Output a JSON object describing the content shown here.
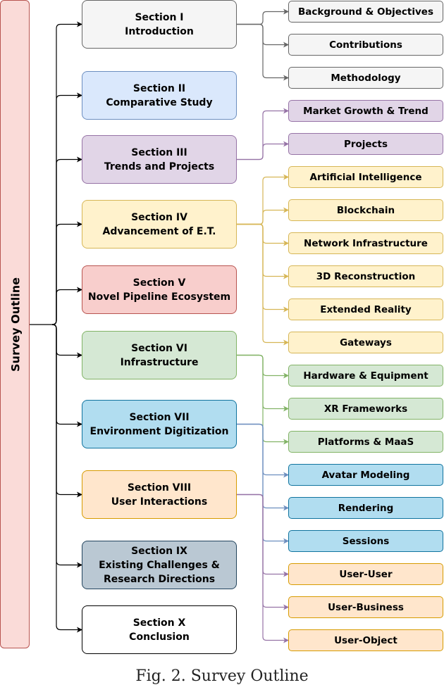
{
  "root": {
    "label": "Survey Outline",
    "fill": "#fadbd8",
    "stroke": "#b85450"
  },
  "sections": [
    {
      "title": "Section I",
      "subtitle": "Introduction",
      "fill": "#f5f5f5",
      "stroke": "#666666",
      "children": [
        "Background & Objectives",
        "Contributions",
        "Methodology"
      ],
      "link_color": "#666666"
    },
    {
      "title": "Section II",
      "subtitle": "Comparative Study",
      "fill": "#dae8fc",
      "stroke": "#6c8ebf",
      "children": []
    },
    {
      "title": "Section III",
      "subtitle": "Trends and Projects",
      "fill": "#e1d5e7",
      "stroke": "#9673a6",
      "children": [
        "Market Growth & Trend",
        "Projects"
      ],
      "link_color": "#9673a6"
    },
    {
      "title": "Section IV",
      "subtitle": "Advancement of E.T.",
      "fill": "#fff2cc",
      "stroke": "#d6b656",
      "children": [
        "Artificial Intelligence",
        "Blockchain",
        "Network Infrastructure",
        "3D Reconstruction",
        "Extended Reality",
        "Gateways"
      ],
      "link_color": "#d6b656"
    },
    {
      "title": "Section V",
      "subtitle": "Novel Pipeline Ecosystem",
      "fill": "#f8cecc",
      "stroke": "#b85450",
      "children": []
    },
    {
      "title": "Section VI",
      "subtitle": "Infrastructure",
      "fill": "#d5e8d4",
      "stroke": "#82b366",
      "children": [
        "Hardware & Equipment",
        "XR Frameworks",
        "Platforms & MaaS"
      ],
      "link_color": "#82b366"
    },
    {
      "title": "Section VII",
      "subtitle": "Environment Digitization",
      "fill": "#b1ddf0",
      "stroke": "#10739e",
      "children": [
        "Avatar Modeling",
        "Rendering",
        "Sessions"
      ],
      "link_color": "#6c8ebf"
    },
    {
      "title": "Section VIII",
      "subtitle": "User Interactions",
      "fill": "#ffe6cc",
      "stroke": "#d79b00",
      "children": [
        "User-User",
        "User-Business",
        "User-Object"
      ],
      "link_color": "#9673a6"
    },
    {
      "title": "Section IX",
      "subtitle": "Existing Challenges & Research Directions",
      "subtitle_lines": [
        "Existing Challenges &",
        "Research Directions"
      ],
      "fill": "#bac8d3",
      "stroke": "#23445d",
      "children": []
    },
    {
      "title": "Section X",
      "subtitle": "Conclusion",
      "fill": "#ffffff",
      "stroke": "#000000",
      "children": []
    }
  ],
  "caption": "Fig. 2. Survey Outline"
}
